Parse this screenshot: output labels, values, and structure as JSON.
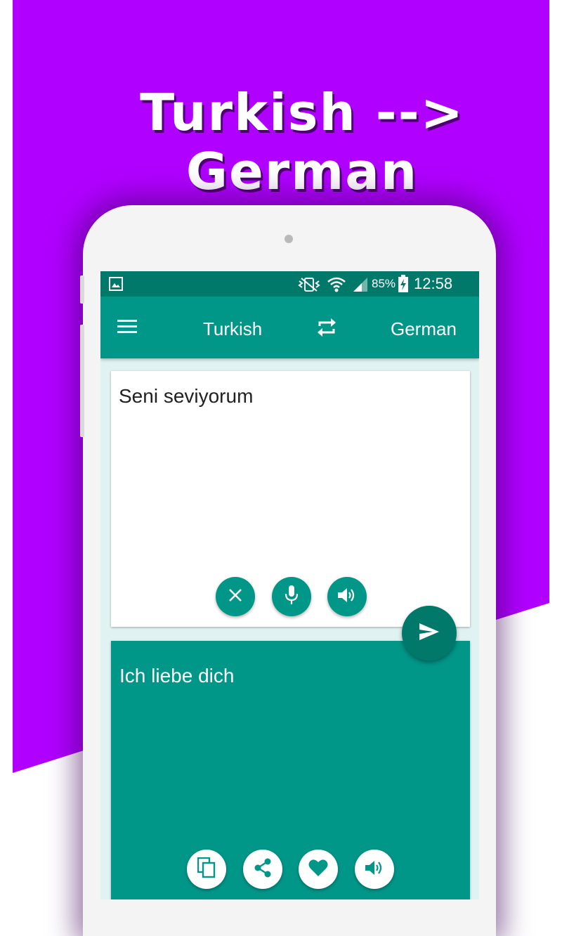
{
  "promo": {
    "headline": "Turkish --> German",
    "background_color": "#b000ff"
  },
  "statusbar": {
    "battery_percent": "85%",
    "time": "12:58",
    "icons": [
      "gallery-icon",
      "vibrate-icon",
      "wifi-icon",
      "signal-icon",
      "battery-charging-icon"
    ]
  },
  "toolbar": {
    "source_language": "Turkish",
    "target_language": "German",
    "icons": [
      "menu-icon",
      "swap-icon"
    ]
  },
  "input": {
    "text": "Seni seviyorum",
    "actions": [
      "clear-icon",
      "mic-icon",
      "speaker-icon"
    ]
  },
  "translate_button": {
    "icon": "send-icon"
  },
  "output": {
    "text": "Ich liebe dich",
    "actions": [
      "copy-icon",
      "share-icon",
      "favorite-icon",
      "speaker-icon"
    ]
  },
  "colors": {
    "primary": "#009688",
    "primary_dark": "#00796b",
    "background": "#e0f2f1"
  }
}
